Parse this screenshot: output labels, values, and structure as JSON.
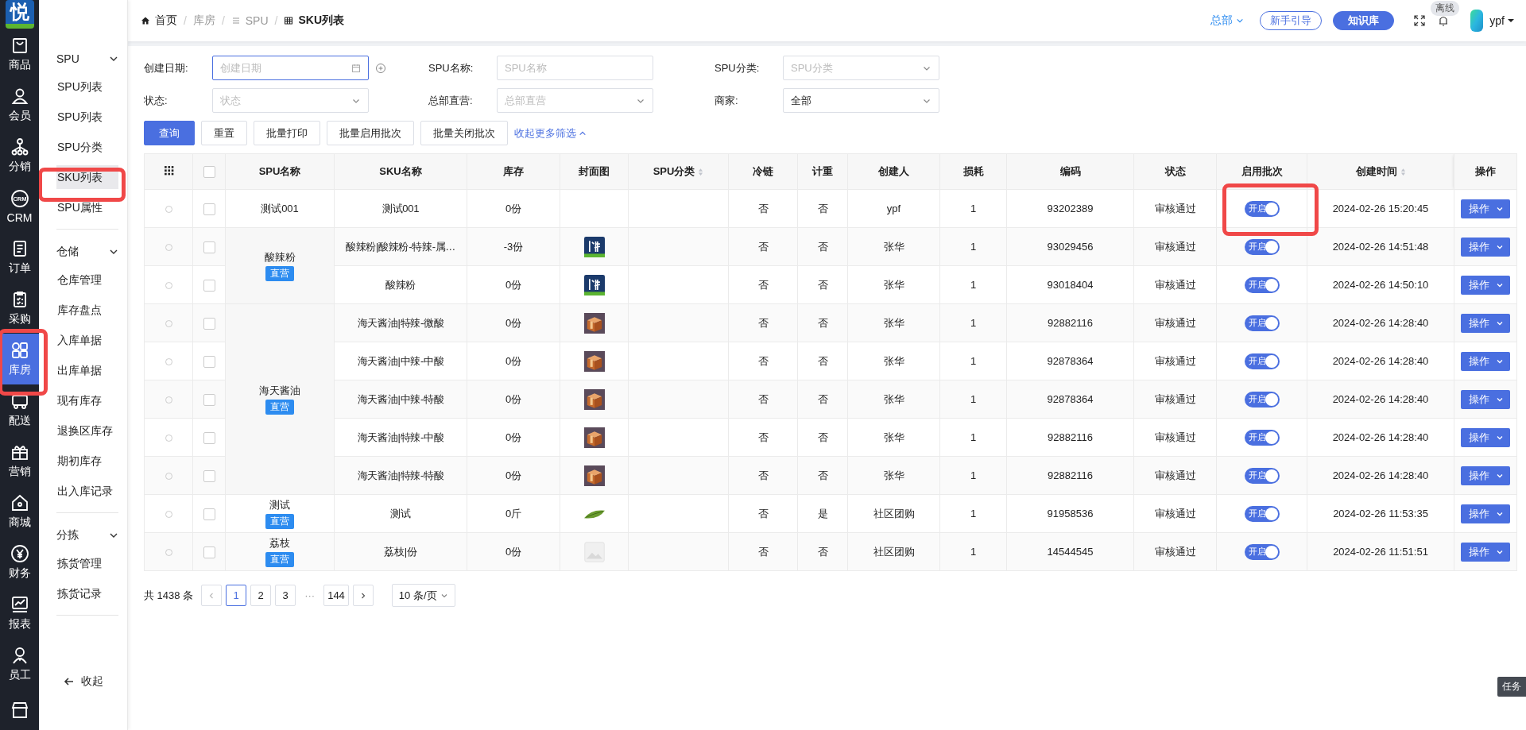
{
  "logo": {
    "text": "悦"
  },
  "nav": {
    "items": [
      {
        "label": "商品",
        "selected": false,
        "annotated": false
      },
      {
        "label": "会员",
        "selected": false,
        "annotated": false
      },
      {
        "label": "分销",
        "selected": false,
        "annotated": false
      },
      {
        "label": "CRM",
        "icon_text": "CRM",
        "selected": false,
        "annotated": false
      },
      {
        "label": "订单",
        "selected": false,
        "annotated": false
      },
      {
        "label": "采购",
        "selected": false,
        "annotated": false
      },
      {
        "label": "库房",
        "selected": true,
        "annotated": true
      },
      {
        "label": "配送",
        "selected": false,
        "annotated": false
      },
      {
        "label": "营销",
        "selected": false,
        "annotated": false
      },
      {
        "label": "商城",
        "selected": false,
        "annotated": false
      },
      {
        "label": "财务",
        "selected": false,
        "annotated": false
      },
      {
        "label": "报表",
        "selected": false,
        "annotated": false
      },
      {
        "label": "员工",
        "selected": false,
        "annotated": false
      },
      {
        "selected": false,
        "annotated": false
      }
    ]
  },
  "menu": {
    "groups": [
      {
        "title": "SPU",
        "expanded": true,
        "items": [
          {
            "label": "SPU列表",
            "selected": false,
            "annotated": false
          },
          {
            "label": "SPU列表",
            "selected": false,
            "annotated": false
          },
          {
            "label": "SPU分类",
            "selected": false,
            "annotated": false
          },
          {
            "label": "SKU列表",
            "selected": true,
            "annotated": true
          },
          {
            "label": "SPU属性",
            "selected": false,
            "annotated": false
          }
        ]
      },
      {
        "title": "仓储",
        "expanded": true,
        "items": [
          {
            "label": "仓库管理",
            "selected": false,
            "annotated": false
          },
          {
            "label": "库存盘点",
            "selected": false,
            "annotated": false
          },
          {
            "label": "入库单据",
            "selected": false,
            "annotated": false
          },
          {
            "label": "出库单据",
            "selected": false,
            "annotated": false
          },
          {
            "label": "现有库存",
            "selected": false,
            "annotated": false
          },
          {
            "label": "退换区库存",
            "selected": false,
            "annotated": false
          },
          {
            "label": "期初库存",
            "selected": false,
            "annotated": false
          },
          {
            "label": "出入库记录",
            "selected": false,
            "annotated": false
          }
        ]
      },
      {
        "title": "分拣",
        "expanded": true,
        "items": [
          {
            "label": "拣货管理",
            "selected": false,
            "annotated": false
          },
          {
            "label": "拣货记录",
            "selected": false,
            "annotated": false
          }
        ]
      }
    ],
    "collapse": "收起"
  },
  "breadcrumb": [
    {
      "label": "首页",
      "kind": "home",
      "current": false
    },
    {
      "sep": "/",
      "label": "库房",
      "kind": "plain",
      "current": false
    },
    {
      "sep": "/",
      "label": "SPU",
      "kind": "list",
      "current": false
    },
    {
      "sep": "/",
      "label": "SKU列表",
      "kind": "grid",
      "current": true
    }
  ],
  "header": {
    "org": "总部",
    "guide_button": "新手引导",
    "kb_button": "知识库",
    "status_badge": "离线",
    "user": "ypf"
  },
  "filters": [
    {
      "label": "创建日期:",
      "kind": "date",
      "placeholder": "创建日期",
      "focused": true
    },
    {
      "label": "SPU名称:",
      "kind": "text",
      "placeholder": "SPU名称",
      "focused": false
    },
    {
      "label": "SPU分类:",
      "kind": "select",
      "placeholder": "SPU分类",
      "focused": false
    },
    {
      "label": "状态:",
      "kind": "select",
      "placeholder": "状态",
      "focused": false
    },
    {
      "label": "总部直营:",
      "kind": "select",
      "placeholder": "总部直营",
      "focused": false
    },
    {
      "label": "商家:",
      "kind": "select",
      "value": "全部",
      "focused": false
    }
  ],
  "actions": [
    {
      "label": "查询",
      "primary": true
    },
    {
      "label": "重置",
      "primary": false
    },
    {
      "label": "批量打印",
      "primary": false
    },
    {
      "label": "批量启用批次",
      "primary": false
    },
    {
      "label": "批量关闭批次",
      "primary": false
    }
  ],
  "more_filters": "收起更多筛选",
  "table": {
    "select_all": false,
    "columns": [
      {
        "kind": "grid"
      },
      {
        "kind": "checkbox"
      },
      {
        "kind": "text",
        "label": "SPU名称",
        "sortable": false
      },
      {
        "kind": "text",
        "label": "SKU名称",
        "sortable": false
      },
      {
        "kind": "text",
        "label": "库存",
        "sortable": false
      },
      {
        "kind": "text",
        "label": "封面图",
        "sortable": false
      },
      {
        "kind": "text",
        "label": "SPU分类",
        "sortable": true
      },
      {
        "kind": "text",
        "label": "冷链",
        "sortable": false
      },
      {
        "kind": "text",
        "label": "计重",
        "sortable": false
      },
      {
        "kind": "text",
        "label": "创建人",
        "sortable": false
      },
      {
        "kind": "text",
        "label": "损耗",
        "sortable": false
      },
      {
        "kind": "text",
        "label": "编码",
        "sortable": false
      },
      {
        "kind": "text",
        "label": "状态",
        "sortable": false
      },
      {
        "kind": "text",
        "label": "启用批次",
        "sortable": false
      },
      {
        "kind": "text",
        "label": "创建时间",
        "sortable": true
      },
      {
        "kind": "text",
        "label": "操作",
        "sortable": false
      }
    ],
    "groups": [
      {
        "spu": "测试001",
        "rows": [
          {
            "selected": false,
            "checked": false,
            "sku": "测试001",
            "stock": "0份",
            "cold_chain": "否",
            "weighed": "否",
            "creator": "ypf",
            "loss": "1",
            "code": "93202389",
            "status": "审核通过",
            "batch_enabled": true,
            "batch_label": "开启",
            "annotated": true,
            "created": "2024-02-26 15:20:45",
            "action": "操作"
          }
        ]
      },
      {
        "spu": "酸辣粉",
        "tag": "直营",
        "rows": [
          {
            "selected": false,
            "checked": false,
            "sku": "酸辣粉|酸辣粉-特辣-属…",
            "stock": "-3份",
            "cover": {
              "kind": "logo"
            },
            "cold_chain": "否",
            "weighed": "否",
            "creator": "张华",
            "loss": "1",
            "code": "93029456",
            "status": "审核通过",
            "batch_enabled": true,
            "batch_label": "开启",
            "created": "2024-02-26 14:51:48",
            "action": "操作"
          },
          {
            "selected": false,
            "checked": false,
            "sku": "酸辣粉",
            "stock": "0份",
            "cover": {
              "kind": "logo"
            },
            "cold_chain": "否",
            "weighed": "否",
            "creator": "张华",
            "loss": "1",
            "code": "93018404",
            "status": "审核通过",
            "batch_enabled": true,
            "batch_label": "开启",
            "created": "2024-02-26 14:50:10",
            "action": "操作"
          }
        ]
      },
      {
        "spu": "海天酱油",
        "tag": "直营",
        "rows": [
          {
            "selected": false,
            "checked": false,
            "sku": "海天酱油|特辣-微酸",
            "stock": "0份",
            "cover": {
              "kind": "box"
            },
            "cold_chain": "否",
            "weighed": "否",
            "creator": "张华",
            "loss": "1",
            "code": "92882116",
            "status": "审核通过",
            "batch_enabled": true,
            "batch_label": "开启",
            "created": "2024-02-26 14:28:40",
            "action": "操作"
          },
          {
            "selected": false,
            "checked": false,
            "sku": "海天酱油|中辣-中酸",
            "stock": "0份",
            "cover": {
              "kind": "box"
            },
            "cold_chain": "否",
            "weighed": "否",
            "creator": "张华",
            "loss": "1",
            "code": "92878364",
            "status": "审核通过",
            "batch_enabled": true,
            "batch_label": "开启",
            "created": "2024-02-26 14:28:40",
            "action": "操作"
          },
          {
            "selected": false,
            "checked": false,
            "sku": "海天酱油|中辣-特酸",
            "stock": "0份",
            "cover": {
              "kind": "box"
            },
            "cold_chain": "否",
            "weighed": "否",
            "creator": "张华",
            "loss": "1",
            "code": "92878364",
            "status": "审核通过",
            "batch_enabled": true,
            "batch_label": "开启",
            "created": "2024-02-26 14:28:40",
            "action": "操作"
          },
          {
            "selected": false,
            "checked": false,
            "sku": "海天酱油|特辣-中酸",
            "stock": "0份",
            "cover": {
              "kind": "box"
            },
            "cold_chain": "否",
            "weighed": "否",
            "creator": "张华",
            "loss": "1",
            "code": "92882116",
            "status": "审核通过",
            "batch_enabled": true,
            "batch_label": "开启",
            "created": "2024-02-26 14:28:40",
            "action": "操作"
          },
          {
            "selected": false,
            "checked": false,
            "sku": "海天酱油|特辣-特酸",
            "stock": "0份",
            "cover": {
              "kind": "box"
            },
            "cold_chain": "否",
            "weighed": "否",
            "creator": "张华",
            "loss": "1",
            "code": "92882116",
            "status": "审核通过",
            "batch_enabled": true,
            "batch_label": "开启",
            "created": "2024-02-26 14:28:40",
            "action": "操作"
          }
        ]
      },
      {
        "spu": "测试",
        "tag": "直营",
        "rows": [
          {
            "selected": false,
            "checked": false,
            "sku": "测试",
            "stock": "0斤",
            "cover": {
              "kind": "leaf"
            },
            "cold_chain": "否",
            "weighed": "是",
            "creator": "社区团购",
            "loss": "1",
            "code": "91958536",
            "status": "审核通过",
            "batch_enabled": true,
            "batch_label": "开启",
            "created": "2024-02-26 11:53:35",
            "action": "操作"
          }
        ]
      },
      {
        "spu": "荔枝",
        "tag": "直营",
        "rows": [
          {
            "selected": false,
            "checked": false,
            "sku": "荔枝|份",
            "stock": "0份",
            "cover": {
              "kind": "placeholder"
            },
            "cold_chain": "否",
            "weighed": "否",
            "creator": "社区团购",
            "loss": "1",
            "code": "14544545",
            "status": "审核通过",
            "batch_enabled": true,
            "batch_label": "开启",
            "created": "2024-02-26 11:51:51",
            "action": "操作"
          }
        ]
      }
    ]
  },
  "pagination": {
    "total": "共 1438 条",
    "pages": [
      {
        "label": "1",
        "kind": "page",
        "selected": true
      },
      {
        "label": "2",
        "kind": "page",
        "selected": false
      },
      {
        "label": "3",
        "kind": "page",
        "selected": false
      },
      {
        "label": "···",
        "kind": "ellipsis",
        "selected": false
      },
      {
        "label": "144",
        "kind": "page",
        "selected": false
      }
    ],
    "page_size": "10 条/页"
  },
  "task_tab": "任务"
}
